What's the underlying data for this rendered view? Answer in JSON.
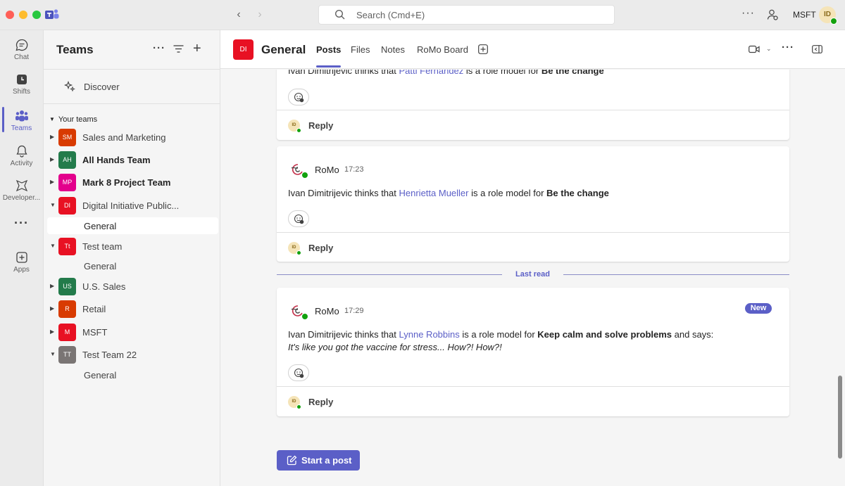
{
  "app": {
    "search_placeholder": "Search (Cmd+E)",
    "org_name": "MSFT",
    "user_initials": "ID",
    "more_glyph": "···"
  },
  "rail": {
    "items": [
      {
        "label": "Chat",
        "icon": "chat-icon"
      },
      {
        "label": "Shifts",
        "icon": "shifts-icon"
      },
      {
        "label": "Teams",
        "icon": "teams-icon",
        "active": true
      },
      {
        "label": "Activity",
        "icon": "bell-icon"
      },
      {
        "label": "Developer...",
        "icon": "developer-icon"
      },
      {
        "label": "Apps",
        "icon": "apps-icon"
      }
    ],
    "more_glyph": "···"
  },
  "teams_panel": {
    "title": "Teams",
    "discover_label": "Discover",
    "section_label": "Your teams",
    "teams": [
      {
        "initials": "SM",
        "name": "Sales and Marketing",
        "color": "#d83b01",
        "bold": false,
        "expanded": false
      },
      {
        "initials": "AH",
        "name": "All Hands Team",
        "color": "#237b4b",
        "bold": true,
        "expanded": false
      },
      {
        "initials": "MP",
        "name": "Mark 8 Project Team",
        "color": "#e3008c",
        "bold": true,
        "expanded": false
      },
      {
        "initials": "DI",
        "name": "Digital Initiative Public...",
        "color": "#e81123",
        "bold": false,
        "expanded": true,
        "channel": "General"
      },
      {
        "initials": "Tt",
        "name": "Test team",
        "color": "#e81123",
        "bold": false,
        "expanded": true,
        "channel": "General"
      },
      {
        "initials": "US",
        "name": "U.S. Sales",
        "color": "#237b4b",
        "bold": false,
        "expanded": false
      },
      {
        "initials": "R",
        "name": "Retail",
        "color": "#d83b01",
        "bold": false,
        "expanded": false
      },
      {
        "initials": "M",
        "name": "MSFT",
        "color": "#e81123",
        "bold": false,
        "expanded": false
      },
      {
        "initials": "TT",
        "name": "Test Team 22",
        "color": "#7a7574",
        "bold": false,
        "expanded": true,
        "channel": "General"
      }
    ]
  },
  "channel": {
    "avatar": "DI",
    "title": "General",
    "tabs": [
      "Posts",
      "Files",
      "Notes",
      "RoMo Board"
    ],
    "active_tab": "Posts"
  },
  "posts": [
    {
      "sender": "",
      "time": "",
      "text_prefix": "Ivan Dimitrijevic thinks that ",
      "person": "Patti Fernandez",
      "text_mid": " is a role model for ",
      "value": "Be the change",
      "reply_label": "Reply"
    },
    {
      "sender": "RoMo",
      "time": "17:23",
      "text_prefix": "Ivan Dimitrijevic thinks that ",
      "person": "Henrietta Mueller",
      "text_mid": " is a role model for ",
      "value": "Be the change",
      "reply_label": "Reply"
    },
    {
      "sender": "RoMo",
      "time": "17:29",
      "badge": "New",
      "text_prefix": "Ivan Dimitrijevic thinks that ",
      "person": "Lynne Robbins",
      "text_mid": " is a role model for ",
      "value": "Keep calm and solve problems",
      "text_suffix": " and says:",
      "quote": "It's like you got the vaccine for stress... How?! How?!",
      "reply_label": "Reply"
    }
  ],
  "divider": {
    "label": "Last read"
  },
  "compose": {
    "start_post_label": "Start a post"
  },
  "colors": {
    "accent": "#5b5fc7",
    "presence": "#13a10e"
  }
}
